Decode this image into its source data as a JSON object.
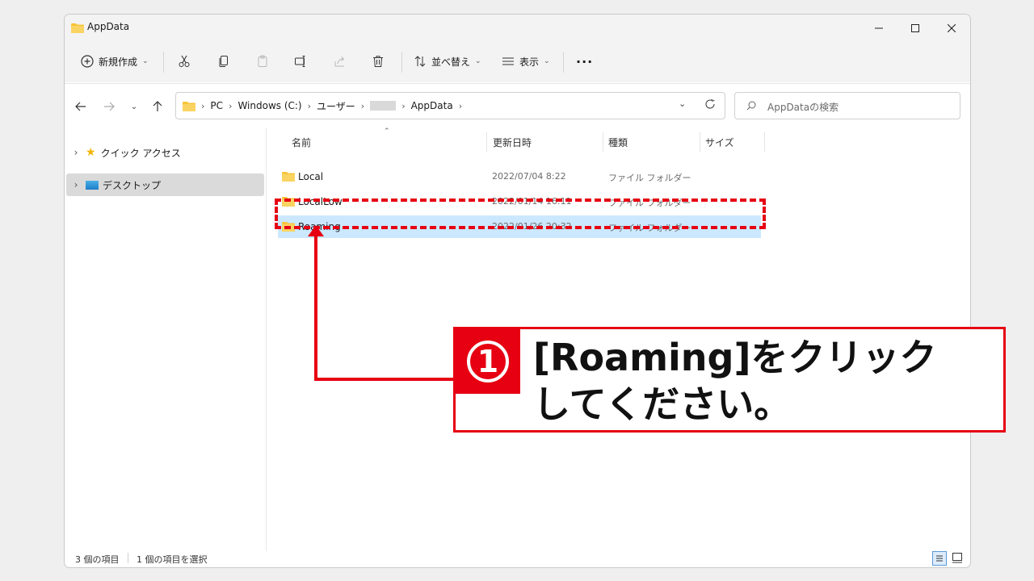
{
  "window": {
    "title": "AppData"
  },
  "toolbar": {
    "new_label": "新規作成",
    "sort_label": "並べ替え",
    "view_label": "表示"
  },
  "address": {
    "crumbs": [
      "PC",
      "Windows (C:)",
      "ユーザー",
      "",
      "AppData"
    ]
  },
  "search": {
    "placeholder": "AppDataの検索"
  },
  "nav": {
    "items": [
      {
        "label": "クイック アクセス"
      },
      {
        "label": "デスクトップ"
      }
    ]
  },
  "columns": {
    "name": "名前",
    "date": "更新日時",
    "type": "種類",
    "size": "サイズ"
  },
  "files": [
    {
      "name": "Local",
      "date": "2022/07/04 8:22",
      "type": "ファイル フォルダー"
    },
    {
      "name": "LocalLow",
      "date": "2022/01/14 16:11",
      "type": "ファイル フォルダー"
    },
    {
      "name": "Roaming",
      "date": "2022/01/26 20:32",
      "type": "ファイル フォルダー"
    }
  ],
  "status": {
    "count": "3 個の項目",
    "selected": "1 個の項目を選択"
  },
  "callout": {
    "number": "1",
    "text": "[Roaming]をクリック\nしてください。"
  },
  "colors": {
    "accent": "#e60012",
    "selection": "#cce8ff",
    "folder": "#f8c43a"
  }
}
